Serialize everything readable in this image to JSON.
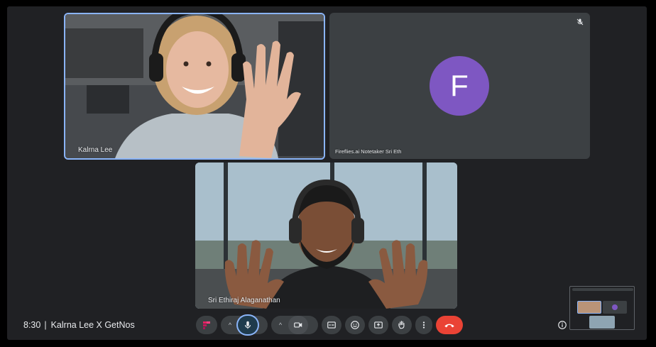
{
  "participants": [
    {
      "name": "Kalrna Lee",
      "role": "speaking"
    },
    {
      "name": "Fireflies.ai Notetaker Sri Eth",
      "initial": "F",
      "muted": true
    },
    {
      "name": "Sri Ethiraj Alaganathan"
    }
  ],
  "meeting": {
    "time": "8:30",
    "separator": "|",
    "title": "Kalrna Lee X GetNos"
  },
  "controls": {
    "fireflies": "fireflies-icon",
    "mic": "mic-icon",
    "camera": "camera-icon",
    "captions": "captions-icon",
    "reactions": "emoji-icon",
    "present": "present-icon",
    "raise_hand": "hand-icon",
    "more": "more-vert-icon",
    "end_call": "end-call-icon",
    "caret": "^"
  },
  "colors": {
    "accent": "#8ab4f8",
    "end_call": "#ea4335",
    "avatar": "#7e57c2",
    "background": "#202124",
    "tile": "#3c4043"
  }
}
